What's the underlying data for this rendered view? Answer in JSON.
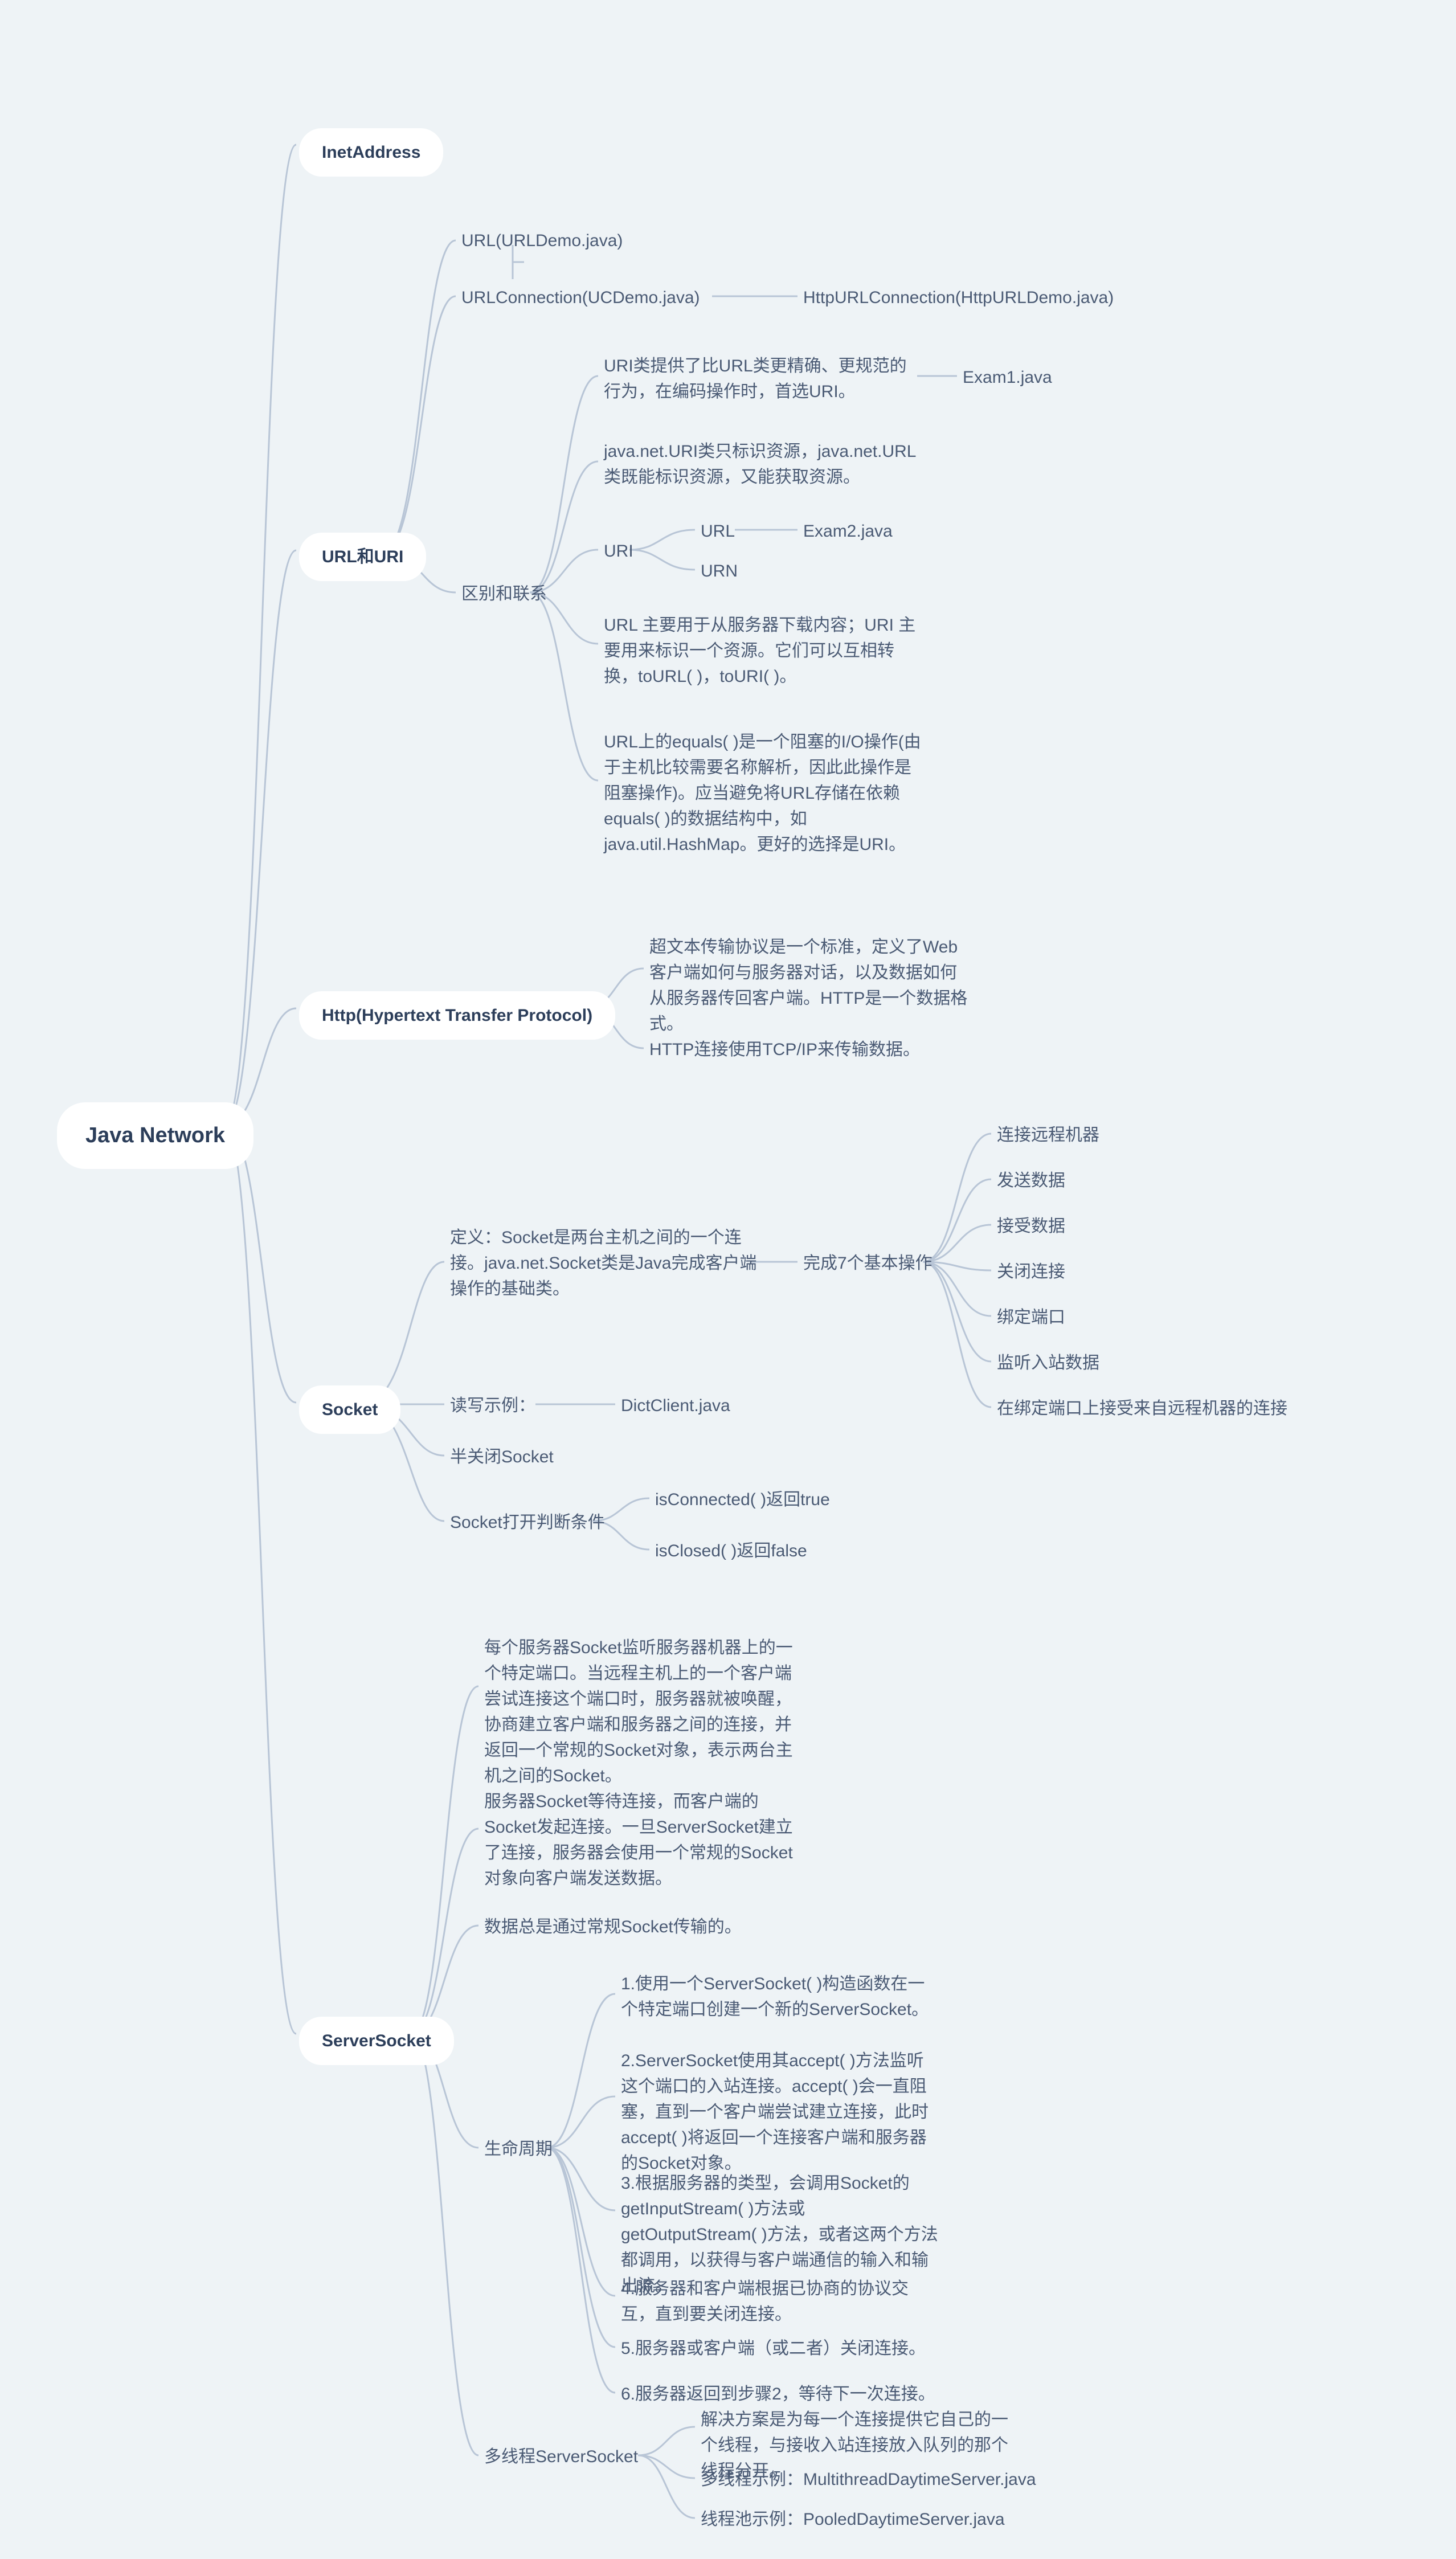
{
  "root": "Java  Network",
  "b": {
    "inetaddress": "InetAddress",
    "urluri": "URL和URI",
    "http": "Http(Hypertext Transfer Protocol)",
    "socket": "Socket",
    "serversocket": "ServerSocket"
  },
  "urluri": {
    "url": "URL(URLDemo.java)",
    "urlconn": "URLConnection(UCDemo.java)",
    "httpurlconn": "HttpURLConnection(HttpURLDemo.java)",
    "diff": "区别和联系",
    "d1": "URI类提供了比URL类更精确、更规范的行为，在编码操作时，首选URI。",
    "d1e": "Exam1.java",
    "d2": "java.net.URI类只标识资源，java.net.URL类既能标识资源，又能获取资源。",
    "uri": "URI",
    "uriurl": "URL",
    "uriurn": "URN",
    "exam2": "Exam2.java",
    "d3": "URL 主要用于从服务器下载内容；URI 主要用来标识一个资源。它们可以互相转换，toURL( )，toURI( )。",
    "d4": "URL上的equals( )是一个阻塞的I/O操作(由于主机比较需要名称解析，因此此操作是阻塞操作)。应当避免将URL存储在依赖equals( )的数据结构中，如java.util.HashMap。更好的选择是URI。"
  },
  "http": {
    "h1": "超文本传输协议是一个标准，定义了Web客户端如何与服务器对话，以及数据如何从服务器传回客户端。HTTP是一个数据格式。",
    "h2": "HTTP连接使用TCP/IP来传输数据。"
  },
  "socket": {
    "def": "定义：Socket是两台主机之间的一个连接。java.net.Socket类是Java完成客户端操作的基础类。",
    "ops": "完成7个基本操作",
    "op1": "连接远程机器",
    "op2": "发送数据",
    "op3": "接受数据",
    "op4": "关闭连接",
    "op5": "绑定端口",
    "op6": "监听入站数据",
    "op7": "在绑定端口上接受来自远程机器的连接",
    "rw": "读写示例：",
    "rwf": "DictClient.java",
    "half": "半关闭Socket",
    "open": "Socket打开判断条件",
    "oc1": "isConnected( )返回true",
    "oc2": "isClosed( )返回false"
  },
  "ss": {
    "s1": "每个服务器Socket监听服务器机器上的一个特定端口。当远程主机上的一个客户端尝试连接这个端口时，服务器就被唤醒，协商建立客户端和服务器之间的连接，并返回一个常规的Socket对象，表示两台主机之间的Socket。",
    "s2": "服务器Socket等待连接，而客户端的Socket发起连接。一旦ServerSocket建立了连接，服务器会使用一个常规的Socket对象向客户端发送数据。",
    "s3": "数据总是通过常规Socket传输的。",
    "life": "生命周期",
    "l1": "1.使用一个ServerSocket( )构造函数在一个特定端口创建一个新的ServerSocket。",
    "l2": "2.ServerSocket使用其accept( )方法监听这个端口的入站连接。accept( )会一直阻塞，直到一个客户端尝试建立连接，此时accept( )将返回一个连接客户端和服务器的Socket对象。",
    "l3": "3.根据服务器的类型，会调用Socket的getInputStream( )方法或getOutputStream( )方法，或者这两个方法都调用，以获得与客户端通信的输入和输出流。",
    "l4": "4.服务器和客户端根据已协商的协议交互，直到要关闭连接。",
    "l5": "5.服务器或客户端（或二者）关闭连接。",
    "l6": "6.服务器返回到步骤2，等待下一次连接。",
    "mt": "多线程ServerSocket",
    "mt1": "解决方案是为每一个连接提供它自己的一个线程，与接收入站连接放入队列的那个线程分开。",
    "mt2": "多线程示例：MultithreadDaytimeServer.java",
    "mt3": "线程池示例：PooledDaytimeServer.java"
  }
}
